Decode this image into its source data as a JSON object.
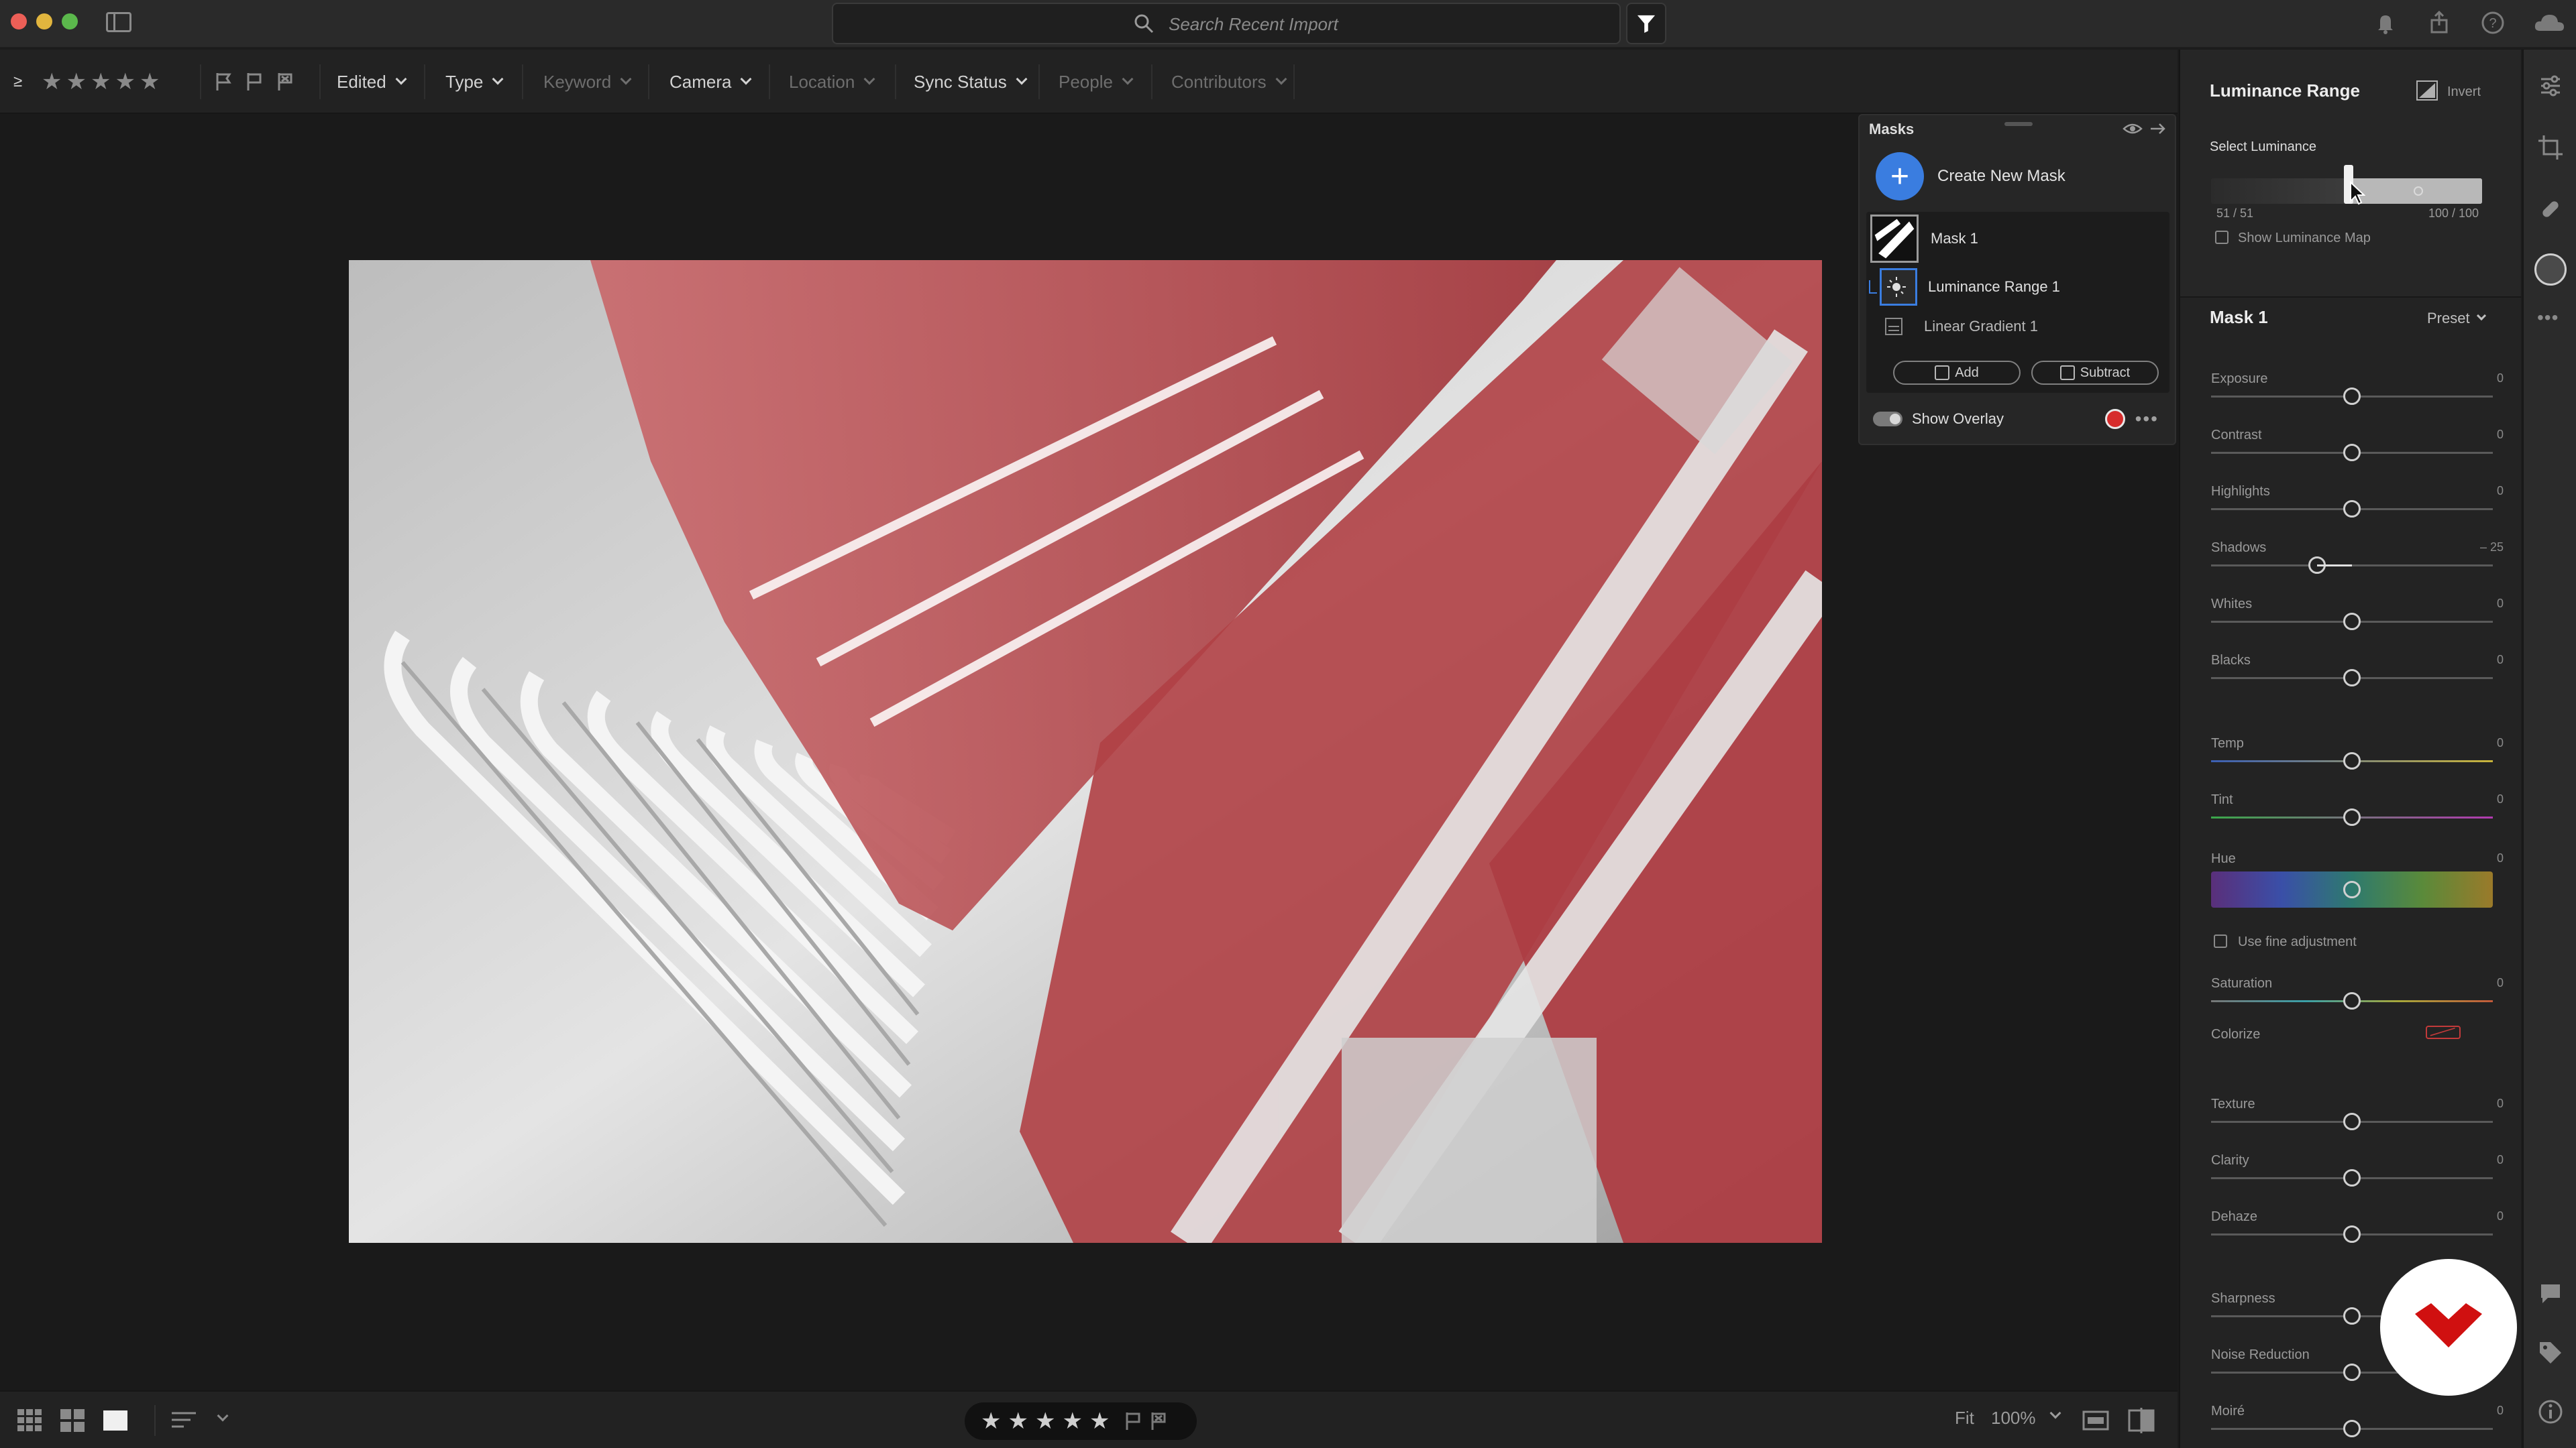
{
  "search": {
    "placeholder": "Search Recent Import"
  },
  "filterbar": {
    "items": [
      {
        "label": "Edited",
        "enabled": true
      },
      {
        "label": "Type",
        "enabled": true
      },
      {
        "label": "Keyword",
        "enabled": false
      },
      {
        "label": "Camera",
        "enabled": true
      },
      {
        "label": "Location",
        "enabled": false
      },
      {
        "label": "Sync Status",
        "enabled": true
      },
      {
        "label": "People",
        "enabled": false
      },
      {
        "label": "Contributors",
        "enabled": false
      }
    ],
    "rating_filter_symbol": "≥"
  },
  "masks": {
    "title": "Masks",
    "create_label": "Create New Mask",
    "mask_name": "Mask 1",
    "components": [
      {
        "label": "Luminance Range 1",
        "icon": "luminance-range-icon"
      },
      {
        "label": "Linear Gradient 1",
        "icon": "linear-gradient-icon"
      }
    ],
    "add_label": "Add",
    "subtract_label": "Subtract",
    "overlay_label": "Show Overlay",
    "overlay_color": "#d62c2c",
    "overlay_on": true
  },
  "luminance": {
    "title": "Luminance Range",
    "invert_label": "Invert",
    "select_label": "Select Luminance",
    "low_value": "51 / 51",
    "high_value": "100 / 100",
    "show_map_label": "Show Luminance Map"
  },
  "mask_adjust": {
    "title": "Mask 1",
    "preset_label": "Preset",
    "sliders": [
      {
        "label": "Exposure",
        "value": "0",
        "level": 0.5
      },
      {
        "label": "Contrast",
        "value": "0",
        "level": 0.5
      },
      {
        "label": "Highlights",
        "value": "0",
        "level": 0.5
      },
      {
        "label": "Shadows",
        "value": "– 25",
        "level": 0.375
      },
      {
        "label": "Whites",
        "value": "0",
        "level": 0.5
      },
      {
        "label": "Blacks",
        "value": "0",
        "level": 0.5
      },
      {
        "label": "Temp",
        "value": "0",
        "level": 0.5
      },
      {
        "label": "Tint",
        "value": "0",
        "level": 0.5
      },
      {
        "label": "Hue",
        "value": "0",
        "level": 0.5
      },
      {
        "label": "Saturation",
        "value": "0",
        "level": 0.5
      },
      {
        "label": "Texture",
        "value": "0",
        "level": 0.5
      },
      {
        "label": "Clarity",
        "value": "0",
        "level": 0.5
      },
      {
        "label": "Dehaze",
        "value": "0",
        "level": 0.5
      },
      {
        "label": "Sharpness",
        "value": "",
        "level": 0.5
      },
      {
        "label": "Noise Reduction",
        "value": "",
        "level": 0.5
      },
      {
        "label": "Moiré",
        "value": "0",
        "level": 0.5
      }
    ],
    "fine_adjust_label": "Use fine adjustment",
    "colorize_label": "Colorize"
  },
  "bottombar": {
    "fit_label": "Fit",
    "zoom_value": "100%"
  },
  "colors": {
    "accent": "#3a7de0",
    "mask_overlay": "#b52a2f"
  }
}
